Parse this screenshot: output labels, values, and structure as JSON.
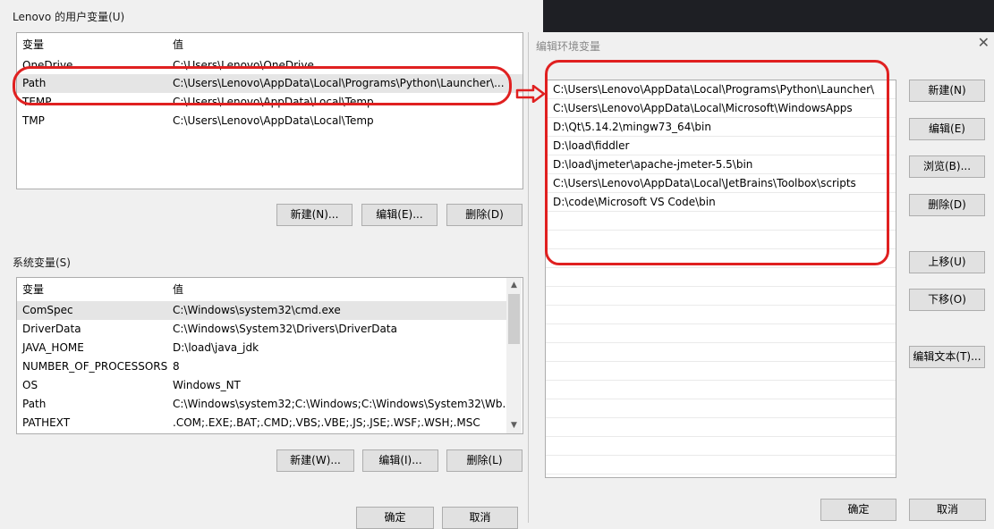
{
  "user_vars": {
    "group_label": "Lenovo 的用户变量(U)",
    "col_var": "变量",
    "col_val": "值",
    "rows": [
      {
        "name": "OneDrive",
        "value": "C:\\Users\\Lenovo\\OneDrive"
      },
      {
        "name": "Path",
        "value": "C:\\Users\\Lenovo\\AppData\\Local\\Programs\\Python\\Launcher\\..."
      },
      {
        "name": "TEMP",
        "value": "C:\\Users\\Lenovo\\AppData\\Local\\Temp"
      },
      {
        "name": "TMP",
        "value": "C:\\Users\\Lenovo\\AppData\\Local\\Temp"
      }
    ],
    "btn_new": "新建(N)...",
    "btn_edit": "编辑(E)...",
    "btn_delete": "删除(D)"
  },
  "sys_vars": {
    "group_label": "系统变量(S)",
    "col_var": "变量",
    "col_val": "值",
    "rows": [
      {
        "name": "ComSpec",
        "value": "C:\\Windows\\system32\\cmd.exe"
      },
      {
        "name": "DriverData",
        "value": "C:\\Windows\\System32\\Drivers\\DriverData"
      },
      {
        "name": "JAVA_HOME",
        "value": "D:\\load\\java_jdk"
      },
      {
        "name": "NUMBER_OF_PROCESSORS",
        "value": "8"
      },
      {
        "name": "OS",
        "value": "Windows_NT"
      },
      {
        "name": "Path",
        "value": "C:\\Windows\\system32;C:\\Windows;C:\\Windows\\System32\\Wb..."
      },
      {
        "name": "PATHEXT",
        "value": ".COM;.EXE;.BAT;.CMD;.VBS;.VBE;.JS;.JSE;.WSF;.WSH;.MSC"
      }
    ],
    "btn_new": "新建(W)...",
    "btn_edit": "编辑(I)...",
    "btn_delete": "删除(L)"
  },
  "main_footer": {
    "ok": "确定",
    "cancel": "取消"
  },
  "edit_dialog": {
    "title": "编辑环境变量",
    "paths": [
      "C:\\Users\\Lenovo\\AppData\\Local\\Programs\\Python\\Launcher\\",
      "C:\\Users\\Lenovo\\AppData\\Local\\Microsoft\\WindowsApps",
      "D:\\Qt\\5.14.2\\mingw73_64\\bin",
      "D:\\load\\fiddler",
      "D:\\load\\jmeter\\apache-jmeter-5.5\\bin",
      "C:\\Users\\Lenovo\\AppData\\Local\\JetBrains\\Toolbox\\scripts",
      "D:\\code\\Microsoft VS Code\\bin"
    ],
    "btn_new": "新建(N)",
    "btn_edit": "编辑(E)",
    "btn_browse": "浏览(B)...",
    "btn_delete": "删除(D)",
    "btn_up": "上移(U)",
    "btn_down": "下移(O)",
    "btn_edit_text": "编辑文本(T)...",
    "ok": "确定",
    "cancel": "取消"
  },
  "colors": {
    "annotation": "#e02020",
    "selected_row": "#e5e5e5"
  }
}
